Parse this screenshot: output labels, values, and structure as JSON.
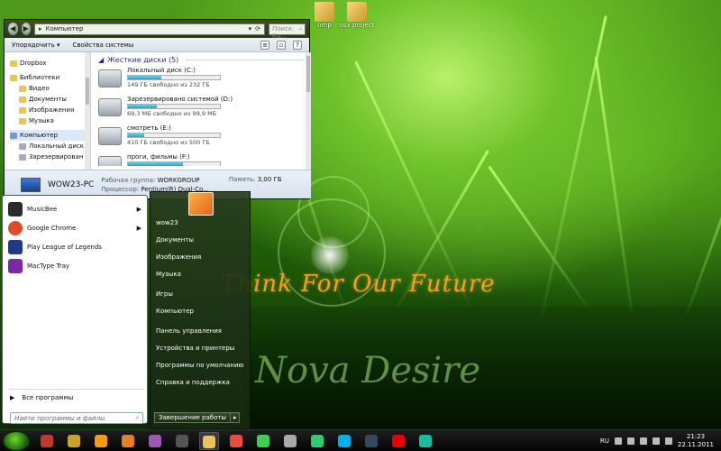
{
  "desktop": {
    "slogan": "Think For Our Future",
    "brand": "Nova Desire",
    "icons": [
      {
        "label": "omp"
      },
      {
        "label": "osx project"
      }
    ]
  },
  "explorer": {
    "address": "Компьютер",
    "search_placeholder": "Поиск: Ко...",
    "toolbar": {
      "organize": "Упорядочить",
      "properties": "Свойства системы",
      "help": "?"
    },
    "nav": [
      {
        "label": "Dropbox"
      },
      {
        "label": "Библиотеки"
      },
      {
        "label": "Видео"
      },
      {
        "label": "Документы"
      },
      {
        "label": "Изображения"
      },
      {
        "label": "Музыка"
      },
      {
        "label": "Компьютер"
      },
      {
        "label": "Локальный диск"
      },
      {
        "label": "Зарезервирован"
      }
    ],
    "group_title": "Жесткие диски (5)",
    "drives": [
      {
        "name": "Локальный диск (C:)",
        "free": "149 ГБ свободно из 232 ГБ",
        "used_fraction": 0.36
      },
      {
        "name": "Зарезервировано системой (D:)",
        "free": "69,3 МБ свободно из 99,9 МБ",
        "used_fraction": 0.31
      },
      {
        "name": "смотреть (E:)",
        "free": "410 ГБ свободно из 500 ГБ",
        "used_fraction": 0.18
      },
      {
        "name": "проги, фильмы (F:)",
        "free": "",
        "used_fraction": 0.6
      }
    ],
    "details": {
      "pc_name": "WOW23-PC",
      "workgroup_label": "Рабочая группа:",
      "workgroup": "WORKGROUP",
      "memory_label": "Память:",
      "memory": "3,00 ГБ",
      "cpu_label": "Процессор:",
      "cpu": "Pentium(R) Dual-Co..."
    }
  },
  "startmenu": {
    "programs": [
      {
        "label": "MusicBee",
        "color": "#2b2b2b",
        "has_arrow": true
      },
      {
        "label": "Google Chrome",
        "color": "#e04a2a",
        "has_arrow": true
      },
      {
        "label": "Play League of Legends",
        "color": "#1f3a8a",
        "has_arrow": false
      },
      {
        "label": "MacType Tray",
        "color": "#7a2aa8",
        "has_arrow": false
      }
    ],
    "all_programs": "Все программы",
    "search_placeholder": "Найти программы и файлы",
    "right": [
      {
        "label": "wow23"
      },
      {
        "label": "Документы"
      },
      {
        "label": "Изображения"
      },
      {
        "label": "Музыка"
      },
      {
        "label": "Игры"
      },
      {
        "label": "Компьютер"
      },
      {
        "label": "Панель управления"
      },
      {
        "label": "Устройства и принтеры"
      },
      {
        "label": "Программы по умолчанию"
      },
      {
        "label": "Справка и поддержка"
      }
    ],
    "shutdown": "Завершение работы"
  },
  "taskbar": {
    "language": "RU",
    "time": "21:23",
    "date": "22.11.2011",
    "apps": [
      {
        "name": "app-1",
        "color": "#c0392b"
      },
      {
        "name": "app-2",
        "color": "#c9a227"
      },
      {
        "name": "app-3",
        "color": "#f39c12"
      },
      {
        "name": "app-4",
        "color": "#e67e22"
      },
      {
        "name": "app-5",
        "color": "#9b59b6"
      },
      {
        "name": "app-6",
        "color": "#555555"
      },
      {
        "name": "explorer",
        "color": "#e8c45a"
      },
      {
        "name": "app-8",
        "color": "#e74c3c"
      },
      {
        "name": "qt",
        "color": "#41cd52"
      },
      {
        "name": "app-10",
        "color": "#aaaaaa"
      },
      {
        "name": "utorrent",
        "color": "#2ecc71"
      },
      {
        "name": "skype",
        "color": "#00aff0"
      },
      {
        "name": "steam",
        "color": "#34495e"
      },
      {
        "name": "opera",
        "color": "#e40000"
      },
      {
        "name": "app-15",
        "color": "#1abc9c"
      }
    ]
  }
}
